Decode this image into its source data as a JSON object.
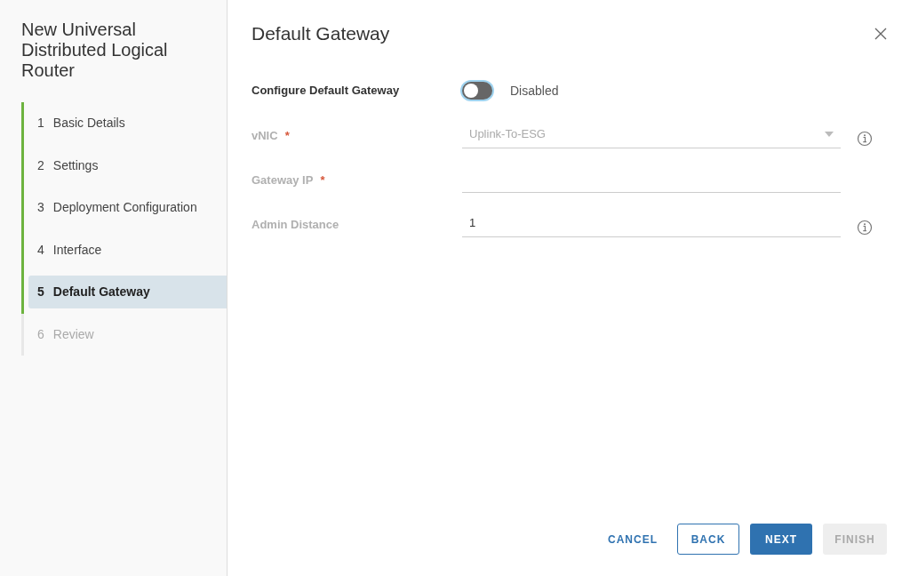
{
  "wizard": {
    "title": "New Universal Distributed Logical Router"
  },
  "steps": [
    {
      "number": "1",
      "label": "Basic Details",
      "completed": true,
      "selected": false
    },
    {
      "number": "2",
      "label": "Settings",
      "completed": true,
      "selected": false
    },
    {
      "number": "3",
      "label": "Deployment Configuration",
      "completed": true,
      "selected": false
    },
    {
      "number": "4",
      "label": "Interface",
      "completed": true,
      "selected": false
    },
    {
      "number": "5",
      "label": "Default Gateway",
      "completed": true,
      "selected": true
    },
    {
      "number": "6",
      "label": "Review",
      "completed": false,
      "selected": false
    }
  ],
  "page": {
    "title": "Default Gateway"
  },
  "toggle": {
    "label": "Configure Default Gateway",
    "on": false,
    "state_text": "Disabled"
  },
  "fields": [
    {
      "kind": "select",
      "label": "vNIC",
      "required_mark": "*",
      "value": "Uplink-To-ESG",
      "disabled": true,
      "info": true
    },
    {
      "kind": "text",
      "label": "Gateway IP",
      "required_mark": "*",
      "disabled": true,
      "info": false
    },
    {
      "kind": "text",
      "label": "Admin Distance",
      "value": "1",
      "disabled": true,
      "info": true
    }
  ],
  "buttons": [
    {
      "kind": "link",
      "label": "CANCEL",
      "disabled": false
    },
    {
      "kind": "outline",
      "label": "BACK",
      "disabled": false
    },
    {
      "kind": "primary",
      "label": "NEXT",
      "disabled": false
    },
    {
      "kind": "primary",
      "label": "FINISH",
      "disabled": true
    }
  ]
}
